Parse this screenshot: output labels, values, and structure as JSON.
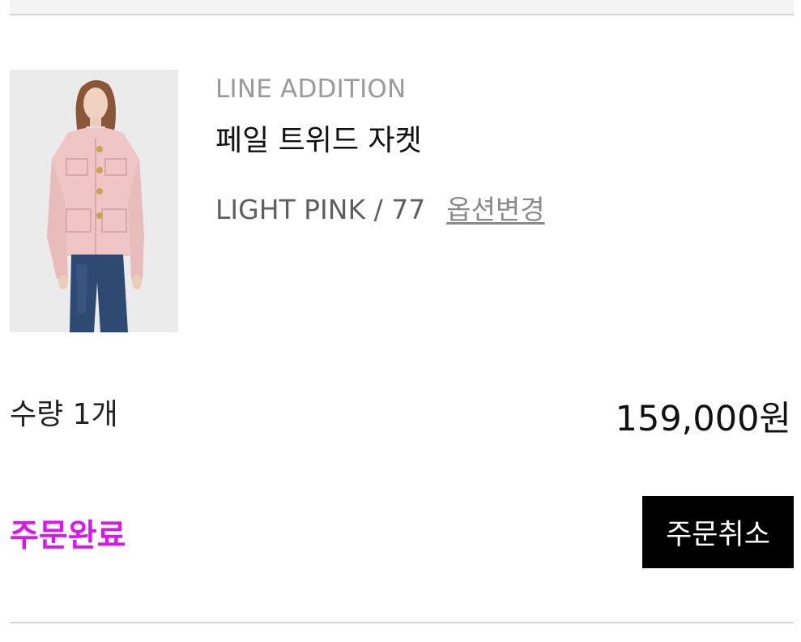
{
  "product": {
    "brand": "LINE ADDITION",
    "name": "페일 트위드 자켓",
    "option": "LIGHT PINK / 77",
    "option_change_label": "옵션변경",
    "image_icon": "product-photo-pink-tweed-jacket"
  },
  "order": {
    "quantity_text": "수량 1개",
    "price_text": "159,000원",
    "status_text": "주문완료",
    "cancel_label": "주문취소"
  },
  "colors": {
    "status": "#d619e8",
    "button_bg": "#000000",
    "button_text": "#ffffff"
  }
}
